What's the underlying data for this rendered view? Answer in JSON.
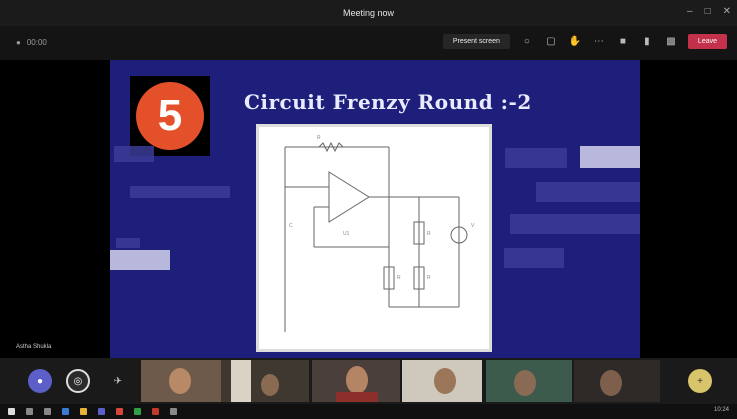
{
  "window": {
    "title": "Meeting now"
  },
  "toolbar": {
    "meeting_time": "00:00",
    "share_label": "Present screen",
    "leave_label": "Leave"
  },
  "slide": {
    "number": "5",
    "title": "Circuit Frenzy Round :-2"
  },
  "stage": {
    "speaker_name": "Astha Shukla"
  },
  "participants": {
    "more_label": "+"
  },
  "taskbar": {
    "clock": "10:24"
  }
}
